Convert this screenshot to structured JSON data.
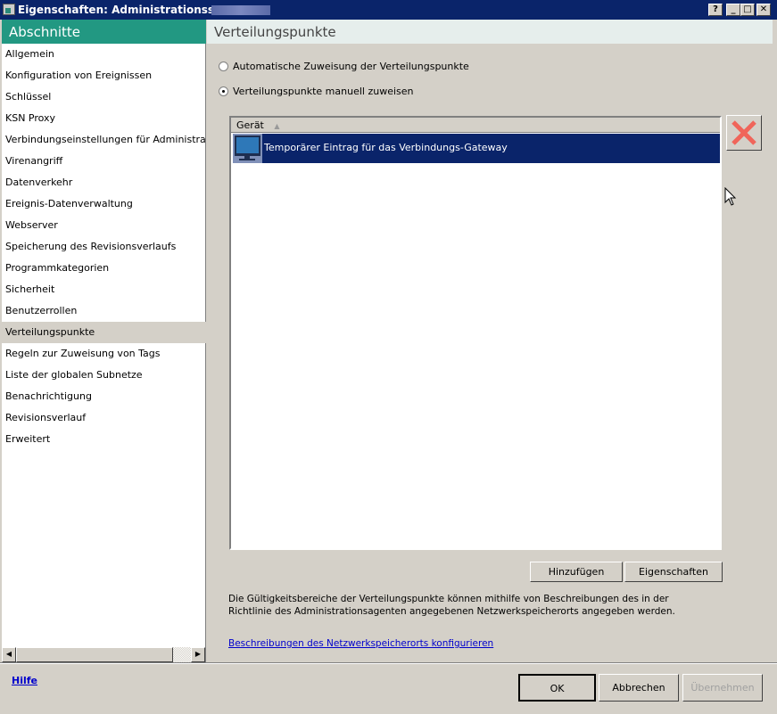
{
  "window": {
    "title": "Eigenschaften: Administrationsserver",
    "help_btn": "?",
    "min_btn": "_",
    "max_btn": "□",
    "close_btn": "✕"
  },
  "sidebar": {
    "title": "Abschnitte",
    "selected": "Verteilungspunkte",
    "items": [
      "Allgemein",
      "Konfiguration von Ereignissen",
      "Schlüssel",
      "KSN Proxy",
      "Verbindungseinstellungen für Administrationsserver",
      "Virenangriff",
      "Datenverkehr",
      "Ereignis-Datenverwaltung",
      "Webserver",
      "Speicherung des Revisionsverlaufs",
      "Programmkategorien",
      "Sicherheit",
      "Benutzerrollen",
      "Verteilungspunkte",
      "Regeln zur Zuweisung von Tags",
      "Liste der globalen Subnetze",
      "Benachrichtigung",
      "Revisionsverlauf",
      "Erweitert"
    ]
  },
  "main": {
    "title": "Verteilungspunkte",
    "radio_auto": "Automatische Zuweisung der Verteilungspunkte",
    "radio_manual": "Verteilungspunkte manuell zuweisen",
    "selected_radio": "manual",
    "list": {
      "column": "Gerät",
      "rows": [
        "Temporärer Eintrag für das Verbindungs-Gateway"
      ]
    },
    "add_button": "Hinzufügen",
    "properties_button": "Eigenschaften",
    "description": "Die Gültigkeitsbereiche der Verteilungspunkte können mithilfe von Beschreibungen des in der Richtlinie des Administrationsagenten angegebenen Netzwerkspeicherorts angegeben werden.",
    "link": "Beschreibungen des Netzwerkspeicherorts konfigurieren"
  },
  "footer": {
    "help": "Hilfe",
    "ok": "OK",
    "cancel": "Abbrechen",
    "apply": "Übernehmen"
  },
  "colors": {
    "titlebar": "#0a246a",
    "sidebar_header": "#229882",
    "delete": "#f0655a"
  }
}
